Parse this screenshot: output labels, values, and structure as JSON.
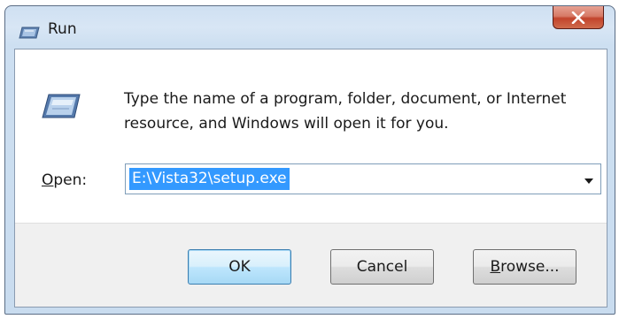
{
  "window": {
    "title": "Run"
  },
  "dialog": {
    "description": "Type the name of a program, folder, document, or Internet resource, and Windows will open it for you.",
    "open_label_mnemonic": "O",
    "open_label_rest": "pen:",
    "open_value": "E:\\Vista32\\setup.exe"
  },
  "buttons": {
    "ok": "OK",
    "cancel": "Cancel",
    "browse_mnemonic": "B",
    "browse_rest": "rowse..."
  },
  "icons": {
    "title": "run-icon",
    "close": "close-icon",
    "dialog": "run-icon",
    "dropdown": "chevron-down-icon"
  },
  "colors": {
    "selection": "#3399ff",
    "close_button": "#c2442c",
    "title_bar": "#cfe0f2"
  }
}
